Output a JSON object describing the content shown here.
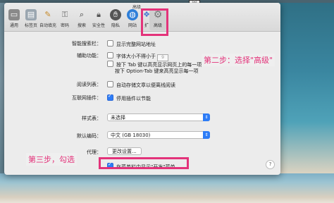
{
  "window": {
    "title": "高级"
  },
  "toolbar": {
    "items": [
      {
        "label": "通用",
        "icon": "switch-icon"
      },
      {
        "label": "标签页",
        "icon": "tabs-icon"
      },
      {
        "label": "自动填充",
        "icon": "pencil-icon"
      },
      {
        "label": "密码",
        "icon": "key-icon"
      },
      {
        "label": "搜索",
        "icon": "search-icon"
      },
      {
        "label": "安全性",
        "icon": "lock-icon"
      },
      {
        "label": "隐私",
        "icon": "hand-icon"
      },
      {
        "label": "网站",
        "icon": "globe-icon"
      },
      {
        "label": "扩",
        "icon": "puzzle-icon"
      },
      {
        "label": "高级",
        "icon": "gear-icon"
      }
    ]
  },
  "settings": {
    "smart_search": {
      "label": "智能搜索栏：",
      "option": "显示完整网站地址"
    },
    "accessibility": {
      "label": "辅助功能：",
      "font_option": "字体大小不得小于",
      "font_value": "9",
      "tab_line1": "按下 Tab 键以高亮显示网页上的每一项",
      "tab_line2": "按下 Option-Tab 键来高亮显示每一项"
    },
    "reading_list": {
      "label": "阅读列表：",
      "option": "自动存储文章以便离线阅读"
    },
    "plugins": {
      "label": "互联网插件：",
      "option": "停用插件以节能"
    },
    "stylesheet": {
      "label": "样式表：",
      "value": "未选择"
    },
    "encoding": {
      "label": "默认编码：",
      "value": "中文 (GB 18030)"
    },
    "proxy": {
      "label": "代理：",
      "button": "更改设置..."
    },
    "develop_menu": {
      "option": "在菜单栏中显示\"开发\"菜单"
    },
    "help_label": "?"
  },
  "annotations": {
    "step2": "第二步：选择\"高级\"",
    "step3": "第三步，勾选",
    "highlight_color": "#e3337a"
  },
  "checkbox_states": {
    "smart_search": false,
    "font_size": false,
    "tab_highlight": false,
    "reading_list": false,
    "plugins": true,
    "develop_menu": true
  },
  "background": {
    "top_box_text": "ioi"
  }
}
